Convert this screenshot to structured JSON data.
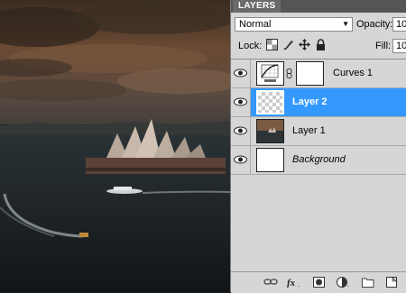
{
  "panel": {
    "tab_label": "LAYERS",
    "blend_mode": "Normal",
    "opacity_label": "Opacity:",
    "opacity_value": "10",
    "lock_label": "Lock:",
    "fill_label": "Fill:",
    "fill_value": "10"
  },
  "layers": [
    {
      "name": "Curves 1",
      "type": "adjustment",
      "visible": true,
      "selected": false
    },
    {
      "name": "Layer 2",
      "type": "transparent",
      "visible": true,
      "selected": true
    },
    {
      "name": "Layer 1",
      "type": "photo",
      "visible": true,
      "selected": false
    },
    {
      "name": "Background",
      "type": "white",
      "visible": true,
      "selected": false,
      "italic": true
    }
  ],
  "icons": {
    "lock": [
      "lock-transparent-pixels-icon",
      "lock-image-pixels-icon",
      "lock-position-icon",
      "lock-all-icon"
    ],
    "bottom": [
      "link-layers-icon",
      "layer-style-fx-icon",
      "add-mask-icon",
      "new-adjustment-layer-icon",
      "new-group-folder-icon",
      "new-layer-icon"
    ]
  },
  "colors": {
    "selection": "#3399ff",
    "panel_bg": "#d6d6d6",
    "tab_bg": "#555555"
  }
}
